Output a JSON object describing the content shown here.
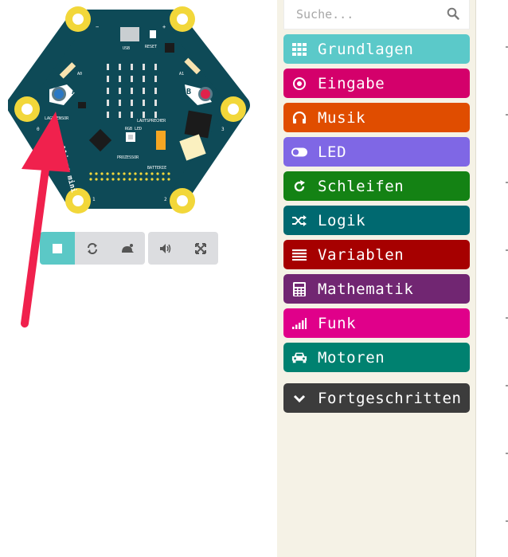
{
  "board": {
    "usb_label": "USB",
    "reset_label": "RESET",
    "button_a": "A",
    "button_b": "B",
    "a0_label": "A0",
    "a1_label": "A1",
    "sensor_label": "LAGESENSOR",
    "speaker_label": "LAUTSPRECHER",
    "rgb_label": "RGB LED",
    "processor_label": "PROZESSOR",
    "battery_label": "BATTERIE",
    "brand_label": "calliope mini",
    "pin_minus": "−",
    "pin_plus": "+",
    "pin_0": "0",
    "pin_1": "1",
    "pin_2": "2",
    "pin_3": "3"
  },
  "sim_toolbar": {
    "buttons": [
      {
        "name": "stop-icon",
        "active": true
      },
      {
        "name": "restart-icon",
        "active": false
      },
      {
        "name": "slowmo-icon",
        "active": false
      },
      {
        "name": "mute-icon",
        "active": false
      },
      {
        "name": "fullscreen-icon",
        "active": false
      }
    ]
  },
  "search": {
    "placeholder": "Suche..."
  },
  "categories": [
    {
      "label": "Grundlagen",
      "color": "#5bc9c9",
      "icon": "grid-icon"
    },
    {
      "label": "Eingabe",
      "color": "#d4006b",
      "icon": "target-icon"
    },
    {
      "label": "Musik",
      "color": "#e04d00",
      "icon": "headphones-icon"
    },
    {
      "label": "LED",
      "color": "#7f67e5",
      "icon": "toggle-icon"
    },
    {
      "label": "Schleifen",
      "color": "#148214",
      "icon": "loop-icon"
    },
    {
      "label": "Logik",
      "color": "#006970",
      "icon": "shuffle-icon"
    },
    {
      "label": "Variablen",
      "color": "#a60000",
      "icon": "list-icon"
    },
    {
      "label": "Mathematik",
      "color": "#712672",
      "icon": "calculator-icon"
    },
    {
      "label": "Funk",
      "color": "#e0008a",
      "icon": "signal-icon"
    },
    {
      "label": "Motoren",
      "color": "#008170",
      "icon": "car-icon"
    },
    {
      "label": "Fortgeschritten",
      "color": "#3c3c3c",
      "icon": "chevron-down-icon"
    }
  ],
  "colors": {
    "board": "#0e4a57",
    "pad": "#f2d73a",
    "arrow": "#f0214d",
    "toolbox_bg": "#f5f2e6"
  }
}
